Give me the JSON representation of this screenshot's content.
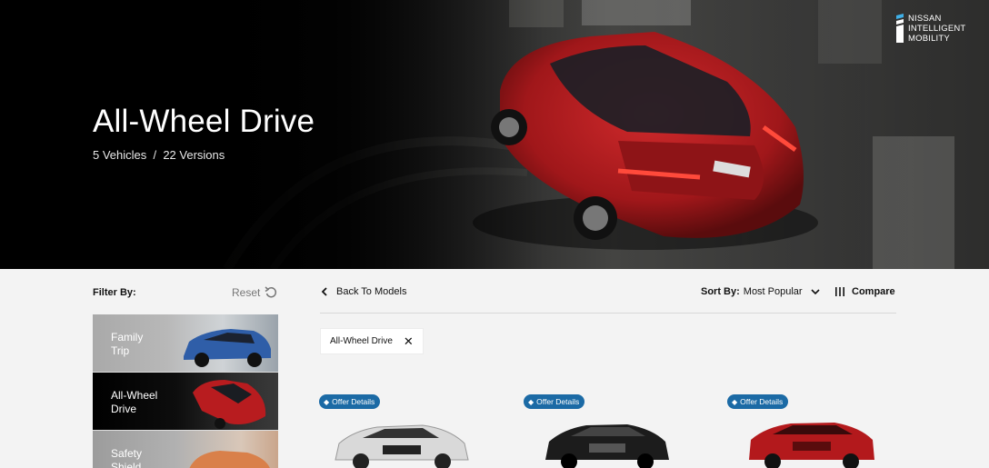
{
  "hero": {
    "title": "All-Wheel Drive",
    "subtitle": "5 Vehicles  /  22 Versions",
    "brand_lines": [
      "NISSAN",
      "INTELLIGENT",
      "MOBILITY"
    ]
  },
  "filter": {
    "label": "Filter By:",
    "reset_label": "Reset",
    "items": [
      {
        "line1": "Family",
        "line2": "Trip"
      },
      {
        "line1": "All-Wheel",
        "line2": "Drive"
      },
      {
        "line1": "Safety",
        "line2": "Shield"
      }
    ]
  },
  "toolbar": {
    "back_label": "Back To Models",
    "sort_prefix": "Sort By:",
    "sort_value": "Most Popular",
    "compare_label": "Compare"
  },
  "active_filter": {
    "label": "All-Wheel Drive"
  },
  "vehicles": [
    {
      "offer_label": "Offer Details",
      "color": "#d9d9d9"
    },
    {
      "offer_label": "Offer Details",
      "color": "#1c1c1c"
    },
    {
      "offer_label": "Offer Details",
      "color": "#b3191c"
    }
  ],
  "colors": {
    "accent": "#1b6aa5",
    "hero_car": "#b01a1d"
  }
}
